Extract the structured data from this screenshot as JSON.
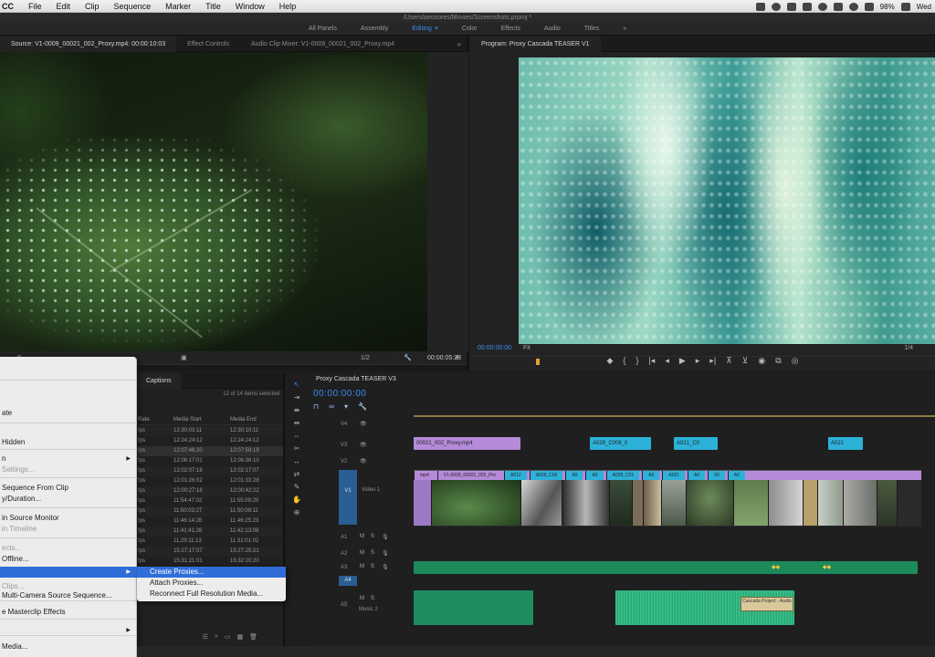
{
  "menubar": {
    "app_name": "CC",
    "items": [
      "File",
      "Edit",
      "Clip",
      "Sequence",
      "Marker",
      "Title",
      "Window",
      "Help"
    ],
    "battery": "98%",
    "clock": "Wed"
  },
  "pathbar": {
    "path": "/Users/aeosores/Movies/Screenshots.prproj *"
  },
  "workspaces": {
    "items": [
      "All Panels",
      "Assembly",
      "Editing",
      "Color",
      "Effects",
      "Audio",
      "Titles"
    ],
    "active": "Editing",
    "overflow": "»"
  },
  "source_panel": {
    "tabs": [
      "Source: V1-0009_00021_002_Proxy.mp4: 00:00:10:03",
      "Effect Controls",
      "Audio Clip Mixer: V1-0009_00021_002_Proxy.mp4"
    ],
    "more": "»",
    "fit": "1/2",
    "timecode": "00:00:05:23"
  },
  "program_panel": {
    "tab": "Program: Proxy Cascada TEASER V1",
    "timecode": "00:00:00:00",
    "fit": "Fit",
    "page": "1/4"
  },
  "project_panel": {
    "tab": "Captions",
    "items_info": "12 of 14 items selected",
    "columns": [
      "Rate",
      "Media Start",
      "Media End"
    ],
    "rows": [
      {
        "rate": "fps",
        "start": "12:30:03:11",
        "end": "12:30:10:11"
      },
      {
        "rate": "fps",
        "start": "12:24:24:12",
        "end": "12:24:24:12"
      },
      {
        "rate": "fps",
        "start": "12:07:46:20",
        "end": "12:07:59:19"
      },
      {
        "rate": "fps",
        "start": "12:06:17:01",
        "end": "12:06:36:10"
      },
      {
        "rate": "fps",
        "start": "12:02:07:18",
        "end": "12:02:17:07"
      },
      {
        "rate": "fps",
        "start": "12:01:26:02",
        "end": "12:01:33:28"
      },
      {
        "rate": "fps",
        "start": "12:00:27:18",
        "end": "12:00:42:22"
      },
      {
        "rate": "fps",
        "start": "11:54:47:02",
        "end": "11:55:09:20"
      },
      {
        "rate": "fps",
        "start": "11:50:03:27",
        "end": "11:50:09:11"
      },
      {
        "rate": "fps",
        "start": "11:46:14:28",
        "end": "11:46:25:23"
      },
      {
        "rate": "fps",
        "start": "11:41:41:26",
        "end": "11:42:13:08"
      },
      {
        "rate": "fps",
        "start": "11:29:11:13",
        "end": "11:31:01:02"
      },
      {
        "rate": "fps",
        "start": "15:27:17:07",
        "end": "15:27:25:21"
      },
      {
        "rate": "fps",
        "start": "15:31:21:01",
        "end": "15:32:20:20"
      }
    ]
  },
  "timeline": {
    "tab": "Proxy Cascada TEASER V3",
    "timecode": "00:00:00:00",
    "tracks": {
      "v4": "V4",
      "v3": "V3",
      "v2": "V2",
      "v1": "V1",
      "v1_name": "Video 1",
      "a1": "A1",
      "a2": "A2",
      "a3": "A3",
      "a4": "A4",
      "a5": "A5",
      "a5_name": "Music 2"
    },
    "clips_v3": [
      {
        "label": "00021_002_Proxy.mp4",
        "color": "purple"
      },
      {
        "label": "A029_C008_0",
        "color": "cyan"
      },
      {
        "label": "A021_C0",
        "color": "cyan"
      },
      {
        "label": "A021",
        "color": "cyan"
      }
    ],
    "v1_labels": [
      "mp4",
      "V1-0009_00021_002_Pro",
      "A012",
      "A029_C00",
      "A0",
      "A0",
      "A029_C01",
      "A0",
      "A021",
      "A0",
      "00",
      "A0"
    ],
    "tooltip": "Cascada Project - Audio"
  },
  "context_menu": {
    "items": [
      {
        "label": "ate",
        "state": "normal"
      },
      {
        "label": "Hidden",
        "state": "normal"
      },
      {
        "label": "n",
        "state": "normal",
        "submenu": true
      },
      {
        "label": "Settings...",
        "state": "dim"
      },
      {
        "label": "Sequence From Clip",
        "state": "normal"
      },
      {
        "label": "y/Duration...",
        "state": "normal"
      },
      {
        "label": "in Source Monitor",
        "state": "normal"
      },
      {
        "label": "in Timeline",
        "state": "dim"
      },
      {
        "label": "ects...",
        "state": "dim"
      },
      {
        "label": "Offline...",
        "state": "normal"
      },
      {
        "label": "",
        "state": "hl",
        "submenu": true
      },
      {
        "label": "Clips...",
        "state": "dim"
      },
      {
        "label": "Multi-Camera Source Sequence...",
        "state": "normal"
      },
      {
        "label": "e Masterclip Effects",
        "state": "normal"
      },
      {
        "label": "",
        "state": "normal",
        "submenu": true
      },
      {
        "label": "Media...",
        "state": "normal"
      }
    ]
  },
  "submenu": {
    "items": [
      "Create Proxies...",
      "Attach Proxies...",
      "Reconnect Full Resolution Media..."
    ]
  },
  "colors": {
    "accent": "#3a8df0",
    "menu_highlight": "#2f6ed8",
    "audio": "#1d8a5c",
    "clip_purple": "#b58ad8",
    "clip_cyan": "#2cb2d9"
  }
}
